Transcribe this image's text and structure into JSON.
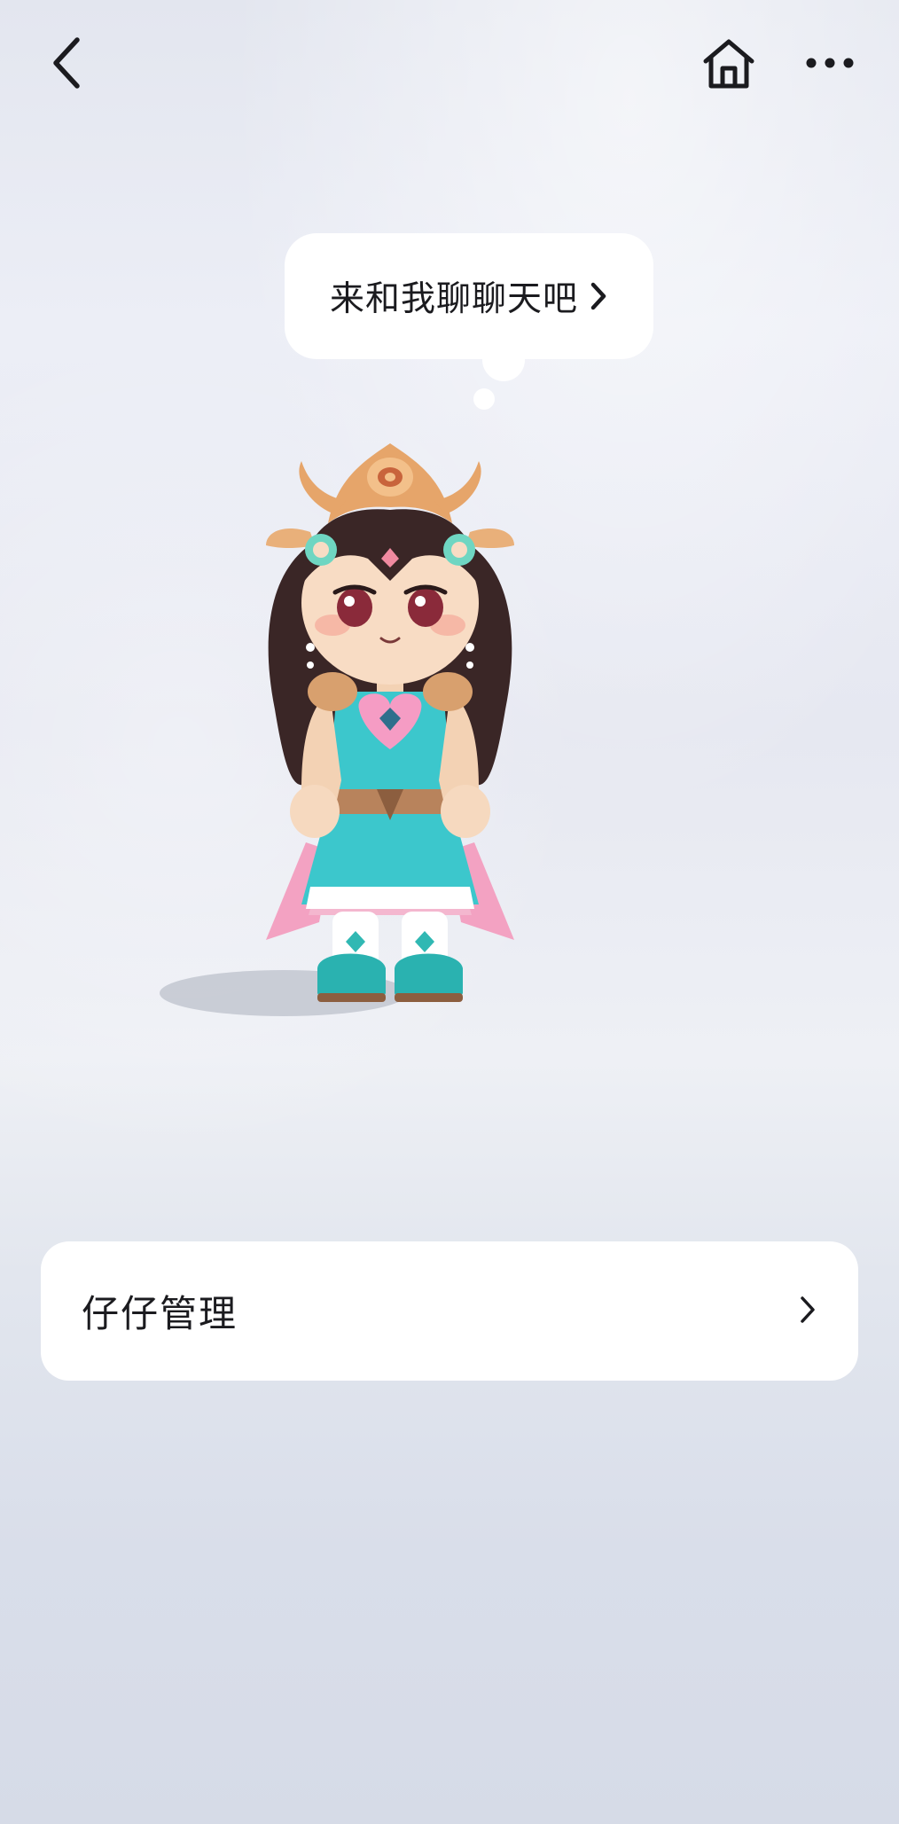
{
  "topbar": {
    "back_icon": "chevron-left-icon",
    "home_icon": "home-icon",
    "more_icon": "more-horizontal-icon"
  },
  "chat_bubble": {
    "text": "来和我聊聊天吧",
    "arrow_icon": "chevron-right-icon"
  },
  "avatar": {
    "icon": "avatar-character-image"
  },
  "manage_card": {
    "label": "仔仔管理",
    "arrow_icon": "chevron-right-icon"
  },
  "colors": {
    "text_primary": "#1b1b1f",
    "card_bg": "#ffffff",
    "bg_top": "#e3e6ef",
    "bg_bottom": "#d6dbe7"
  }
}
